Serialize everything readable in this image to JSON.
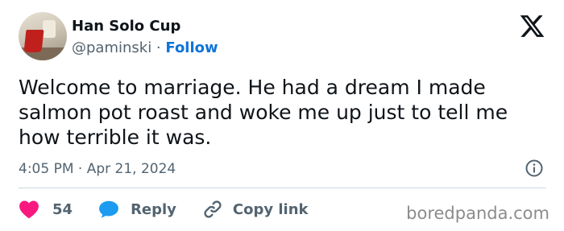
{
  "author": {
    "name": "Han Solo Cup",
    "handle": "@paminski",
    "separator": " · ",
    "follow_label": "Follow"
  },
  "tweet": {
    "text": "Welcome to marriage.  He had a dream I made\nsalmon pot roast and woke me up just to tell me\nhow terrible it was.",
    "timestamp": "4:05 PM · Apr 21, 2024"
  },
  "actions": {
    "like_count": "54",
    "reply_label": "Reply",
    "copy_link_label": "Copy link"
  },
  "watermark": "boredpanda.com",
  "colors": {
    "follow": "#0f74d9",
    "heart": "#f91880",
    "reply_bubble": "#1d9bf0",
    "secondary_text": "#536471"
  },
  "icons": {
    "brand": "x-logo-icon",
    "info": "info-icon",
    "like": "heart-icon",
    "reply": "speech-bubble-icon",
    "copy": "link-icon"
  }
}
